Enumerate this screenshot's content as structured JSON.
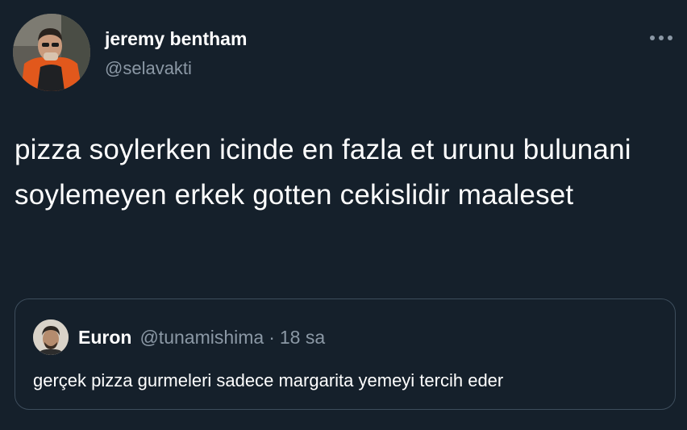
{
  "author": {
    "name": "jeremy bentham",
    "handle": "@selavakti"
  },
  "tweet": {
    "text": "pizza soylerken icinde en fazla et urunu bulunani soylemeyen erkek gotten cekislidir maaleset"
  },
  "quoted_tweet": {
    "name": "Euron",
    "handle": "@tunamishima",
    "separator": "·",
    "time": "18 sa",
    "text": "gerçek pizza gurmeleri sadece margarita yemeyi tercih eder"
  },
  "icons": {
    "more": "more-horizontal-icon"
  },
  "colors": {
    "background": "#15202b",
    "secondary_text": "#8b98a5",
    "border": "#3d4d5c",
    "primary_text": "#ffffff"
  }
}
